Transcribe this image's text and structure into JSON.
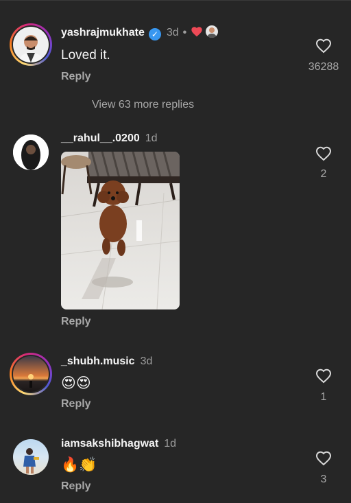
{
  "comments": [
    {
      "username": "yashrajmukhate",
      "time": "3d",
      "text": "Loved it.",
      "reply": "Reply",
      "likes": "36288",
      "view_replies": "View 63 more replies"
    },
    {
      "username": "__rahul__.0200",
      "time": "1d",
      "reply": "Reply",
      "likes": "2"
    },
    {
      "username": "_shubh.music",
      "time": "3d",
      "text": "😍😍",
      "reply": "Reply",
      "likes": "1"
    },
    {
      "username": "iamsakshibhagwat",
      "time": "1d",
      "text": "🔥👏",
      "reply": "Reply",
      "likes": "3"
    }
  ],
  "icons": {
    "like": "heart-outline-icon",
    "verified": "verified-badge-icon",
    "creator_liked": "red-heart-icon"
  },
  "colors": {
    "background": "#262626",
    "secondary_text": "#a8a8a8",
    "verified_blue": "#3897f0",
    "heart_red": "#ed4956"
  }
}
